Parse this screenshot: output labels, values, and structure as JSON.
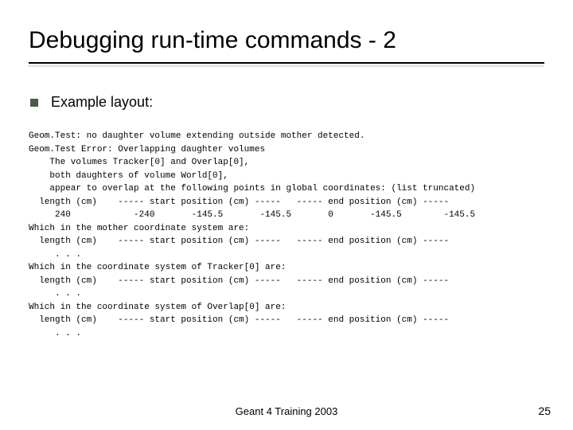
{
  "title": "Debugging run-time commands - 2",
  "bullet": "Example layout:",
  "code": "Geom.Test: no daughter volume extending outside mother detected.\nGeom.Test Error: Overlapping daughter volumes\n    The volumes Tracker[0] and Overlap[0],\n    both daughters of volume World[0],\n    appear to overlap at the following points in global coordinates: (list truncated)\n  length (cm)    ----- start position (cm) -----   ----- end position (cm) -----\n     240            -240       -145.5       -145.5       0       -145.5        -145.5\nWhich in the mother coordinate system are:\n  length (cm)    ----- start position (cm) -----   ----- end position (cm) -----\n     . . .\nWhich in the coordinate system of Tracker[0] are:\n  length (cm)    ----- start position (cm) -----   ----- end position (cm) -----\n     . . .\nWhich in the coordinate system of Overlap[0] are:\n  length (cm)    ----- start position (cm) -----   ----- end position (cm) -----\n     . . .",
  "footer_center": "Geant 4 Training 2003",
  "footer_right": "25"
}
